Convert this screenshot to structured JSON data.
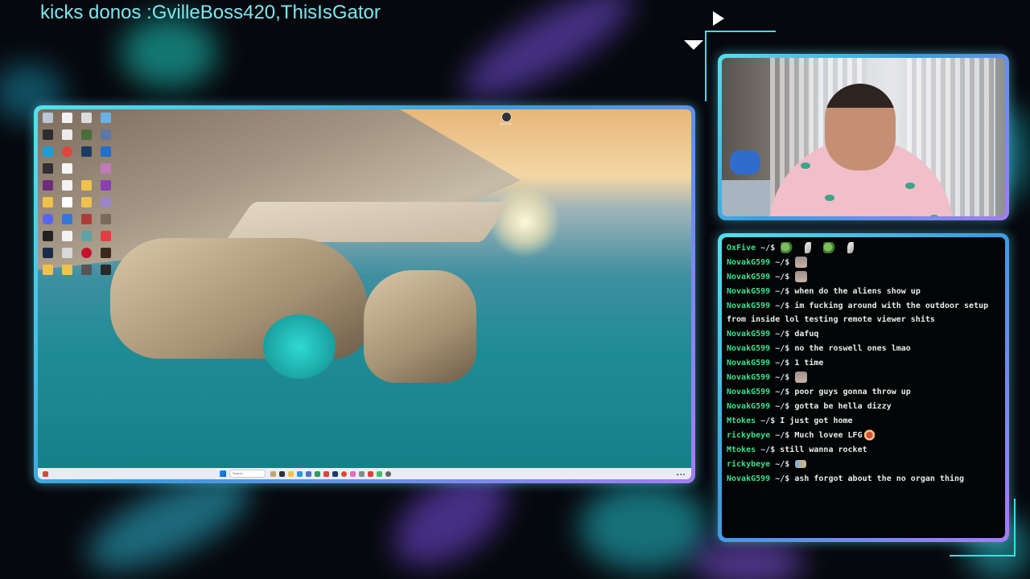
{
  "overlay": {
    "donation_banner": "kicks donos :GvilleBoss420,ThisIsGator"
  },
  "colors": {
    "frame_gradient_start": "#52e3ea",
    "frame_gradient_end": "#a47cf6",
    "chat_username": "#39e28f",
    "banner_text": "#7fe6ee"
  },
  "desktop": {
    "recycle_bin_label": "Recycle Bin",
    "taskbar": {
      "search_placeholder": "Search",
      "start_icon": "windows-start-icon"
    }
  },
  "chat": {
    "prompt_suffix": "~/$",
    "messages": [
      {
        "user": "OxFive",
        "text": "",
        "emotes": [
          "frog-emote",
          "feather-emote",
          "frog-emote",
          "feather-emote"
        ]
      },
      {
        "user": "NovakG599",
        "text": "",
        "emotes": [
          "face-emote"
        ]
      },
      {
        "user": "NovakG599",
        "text": "",
        "emotes": [
          "face-emote"
        ]
      },
      {
        "user": "NovakG599",
        "text": "when do the aliens show up",
        "emotes": []
      },
      {
        "user": "NovakG599",
        "text": "im fucking around with the outdoor setup from inside lol testing remote viewer shits",
        "emotes": []
      },
      {
        "user": "NovakG599",
        "text": "dafuq",
        "emotes": []
      },
      {
        "user": "NovakG599",
        "text": "no the roswell ones lmao",
        "emotes": []
      },
      {
        "user": "NovakG599",
        "text": "1 time",
        "emotes": []
      },
      {
        "user": "NovakG599",
        "text": "",
        "emotes": [
          "face-emote"
        ]
      },
      {
        "user": "NovakG599",
        "text": "poor guys gonna throw up",
        "emotes": []
      },
      {
        "user": "NovakG599",
        "text": "gotta be hella dizzy",
        "emotes": []
      },
      {
        "user": "Mtokes",
        "text": "I just got home",
        "emotes": []
      },
      {
        "user": "rickybeye",
        "text": "Much lovee LFG",
        "emotes": [
          "character-emote"
        ]
      },
      {
        "user": "Mtokes",
        "text": "still wanna rocket",
        "emotes": []
      },
      {
        "user": "rickybeye",
        "text": "",
        "emotes": [
          "small-emote"
        ]
      },
      {
        "user": "NovakG599",
        "text": "ash forgot about the no organ thing",
        "emotes": []
      }
    ]
  }
}
